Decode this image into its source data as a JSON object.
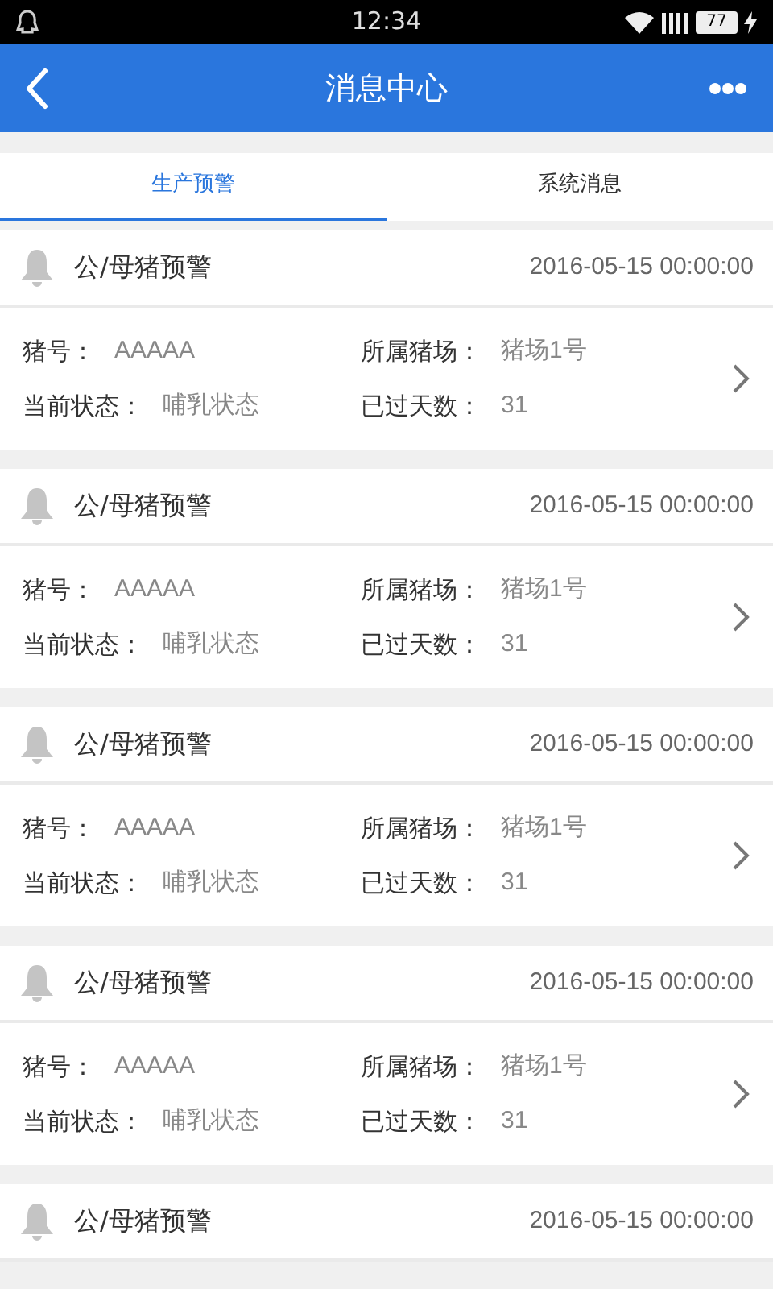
{
  "status_bar": {
    "time": "12:34",
    "battery": "77"
  },
  "header": {
    "title": "消息中心"
  },
  "tabs": [
    {
      "label": "生产预警",
      "selected": true
    },
    {
      "label": "系统消息",
      "selected": false
    }
  ],
  "messages": [
    {
      "title": "公/母猪预警",
      "time": "2016-05-15 00:00:00",
      "fields": [
        {
          "label": "猪号：",
          "value": "AAAAA"
        },
        {
          "label": "所属猪场：",
          "value": "猪场1号"
        },
        {
          "label": "当前状态：",
          "value": "哺乳状态"
        },
        {
          "label": "已过天数：",
          "value": "31"
        }
      ]
    },
    {
      "title": "公/母猪预警",
      "time": "2016-05-15 00:00:00",
      "fields": [
        {
          "label": "猪号：",
          "value": "AAAAA"
        },
        {
          "label": "所属猪场：",
          "value": "猪场1号"
        },
        {
          "label": "当前状态：",
          "value": "哺乳状态"
        },
        {
          "label": "已过天数：",
          "value": "31"
        }
      ]
    },
    {
      "title": "公/母猪预警",
      "time": "2016-05-15 00:00:00",
      "fields": [
        {
          "label": "猪号：",
          "value": "AAAAA"
        },
        {
          "label": "所属猪场：",
          "value": "猪场1号"
        },
        {
          "label": "当前状态：",
          "value": "哺乳状态"
        },
        {
          "label": "已过天数：",
          "value": "31"
        }
      ]
    },
    {
      "title": "公/母猪预警",
      "time": "2016-05-15 00:00:00",
      "fields": [
        {
          "label": "猪号：",
          "value": "AAAAA"
        },
        {
          "label": "所属猪场：",
          "value": "猪场1号"
        },
        {
          "label": "当前状态：",
          "value": "哺乳状态"
        },
        {
          "label": "已过天数：",
          "value": "31"
        }
      ]
    },
    {
      "title": "公/母猪预警",
      "time": "2016-05-15 00:00:00"
    }
  ]
}
